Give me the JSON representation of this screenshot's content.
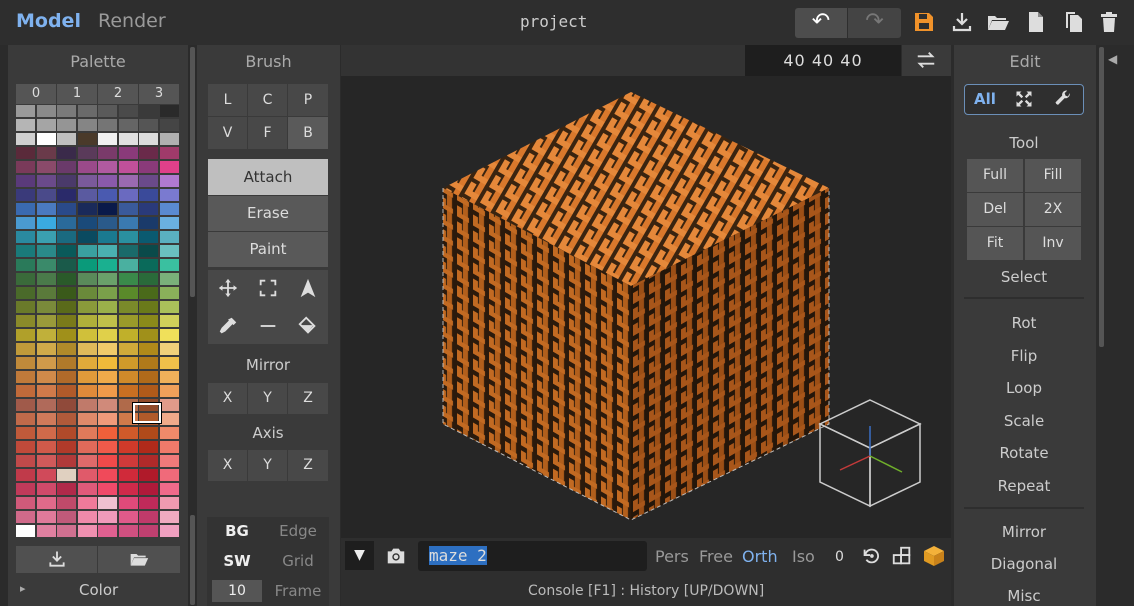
{
  "top": {
    "modes": [
      "Model",
      "Render"
    ],
    "project_title": "project",
    "undo_icon": "undo-arrow",
    "redo_icon": "redo-arrow",
    "icons": [
      "save-icon",
      "download-icon",
      "folder-open-icon",
      "new-file-icon",
      "copy-icon",
      "trash-icon"
    ],
    "accent": "#7fb2ef",
    "save_color": "#f0922a"
  },
  "palette": {
    "title": "Palette",
    "tabs": [
      "0",
      "1",
      "2",
      "3"
    ],
    "footer_label": "Color",
    "footer_arrow": "▸"
  },
  "brush": {
    "title": "Brush",
    "shape_buttons": [
      "L",
      "C",
      "P",
      "V",
      "F",
      "B"
    ],
    "modes": [
      "Attach",
      "Erase",
      "Paint"
    ],
    "mirror_label": "Mirror",
    "mirror_buttons": [
      "X",
      "Y",
      "Z"
    ],
    "axis_label": "Axis",
    "axis_buttons": [
      "X",
      "Y",
      "Z"
    ],
    "bottom": {
      "bg": "BG",
      "edge": "Edge",
      "sw": "SW",
      "grid": "Grid",
      "frame_value": "10",
      "frame": "Frame"
    }
  },
  "viewport": {
    "dims": "40  40  40",
    "model_name": "maze 2",
    "view_modes": [
      "Pers",
      "Free",
      "Orth",
      "Iso"
    ],
    "active_view": "Orth",
    "rotation_count": "0",
    "console_text": "Console [F1] : History [UP/DOWN]",
    "voxel_color": "#c86f22"
  },
  "edit": {
    "title": "Edit",
    "filter_all": "All",
    "tool_label": "Tool",
    "tool_buttons": [
      "Full",
      "Fill",
      "Del",
      "2X",
      "Fit",
      "Inv"
    ],
    "select_label": "Select",
    "ops": [
      "Rot",
      "Flip",
      "Loop",
      "Scale",
      "Rotate",
      "Repeat"
    ],
    "ops2": [
      "Mirror",
      "Diagonal",
      "Misc"
    ],
    "collapse_icon": "◀"
  }
}
